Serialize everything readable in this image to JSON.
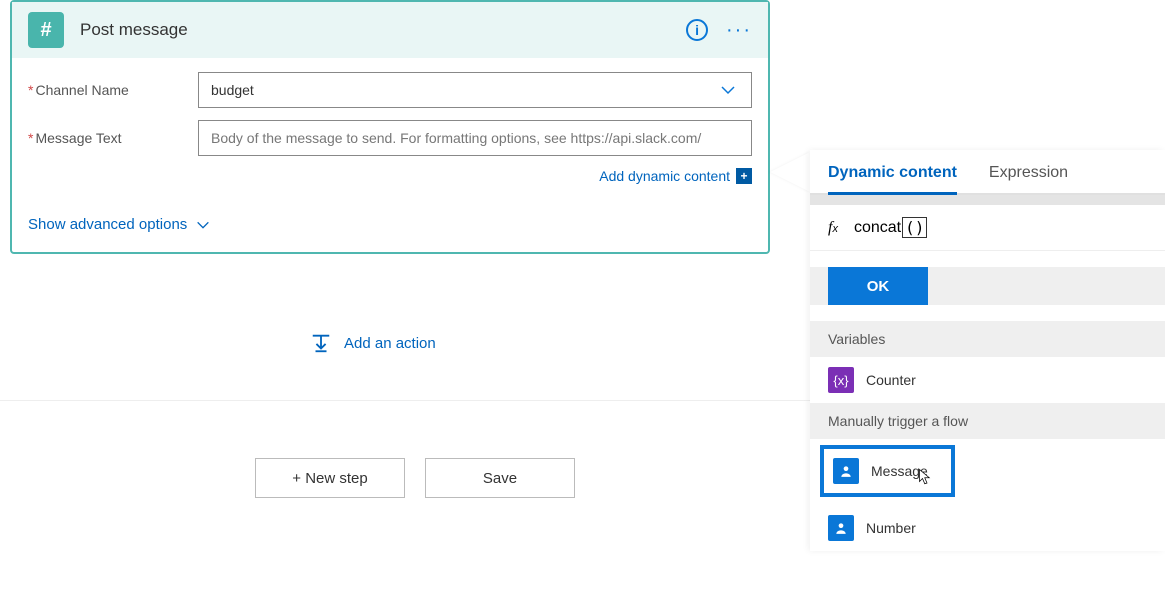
{
  "card": {
    "title": "Post message",
    "fields": {
      "channel": {
        "label": "Channel Name",
        "value": "budget"
      },
      "message": {
        "label": "Message Text",
        "placeholder": "Body of the message to send. For formatting options, see https://api.slack.com/"
      }
    },
    "add_dynamic": "Add dynamic content",
    "advanced": "Show advanced options"
  },
  "links": {
    "add_action": "Add an action"
  },
  "buttons": {
    "new_step": "+ New step",
    "save": "Save"
  },
  "panel": {
    "tabs": {
      "dynamic": "Dynamic content",
      "expression": "Expression"
    },
    "fx_text": "concat",
    "fx_parens": "()",
    "ok": "OK",
    "sections": {
      "variables": "Variables",
      "manual": "Manually trigger a flow"
    },
    "items": {
      "counter": "Counter",
      "message": "Message",
      "number": "Number"
    }
  }
}
